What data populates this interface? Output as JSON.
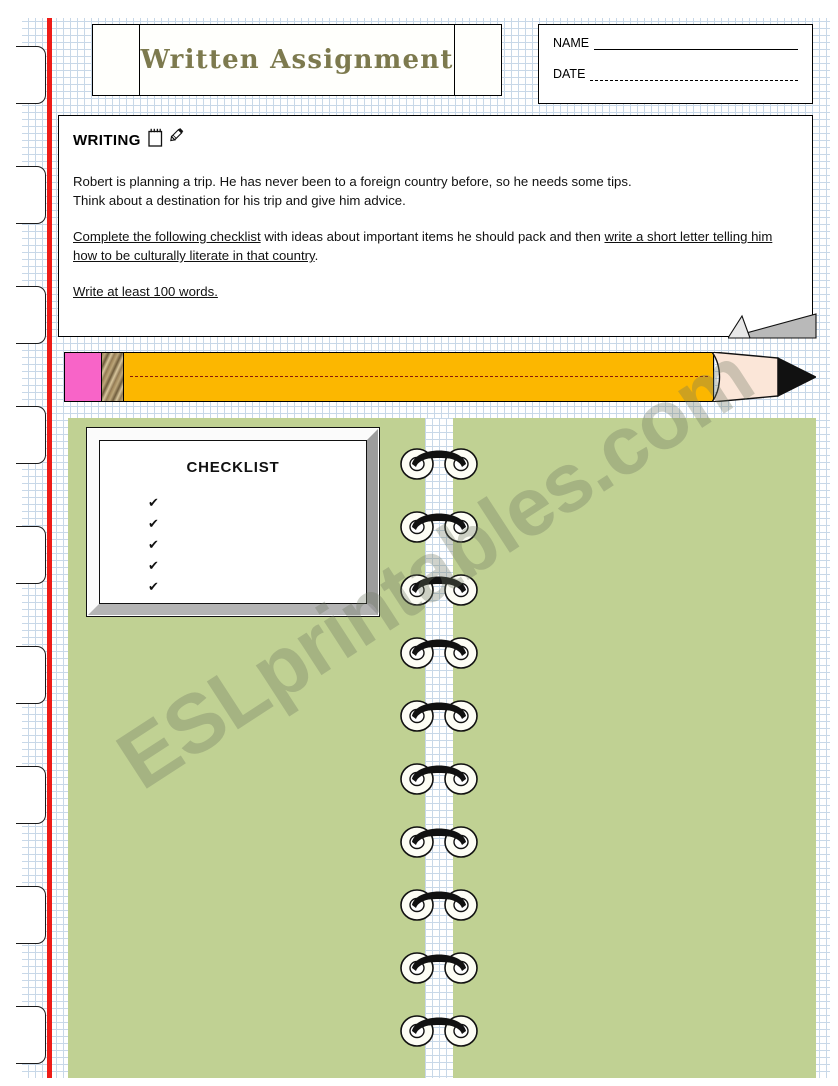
{
  "header": {
    "title": "Written Assignment",
    "name_label": "NAME",
    "date_label": "DATE"
  },
  "writing_section": {
    "heading": "WRITING",
    "heading_icons": [
      "notepad-icon",
      "pencil-icon"
    ],
    "paragraph_1_line_1": "Robert is planning a trip. He has never been to a foreign country before, so he needs some tips.",
    "paragraph_1_line_2": "Think about a destination for his trip and give him advice.",
    "paragraph_2_underlined_1": "Complete the following checklist",
    "paragraph_2_plain_1": " with ideas about important items he should pack and then ",
    "paragraph_2_underlined_2": "write a short letter telling him how to be culturally literate in that country",
    "paragraph_2_plain_2": ".",
    "paragraph_3": "Write at least 100 words."
  },
  "pencil": {
    "eraser_color": "#f864c8",
    "body_color": "#fcb700",
    "wood_color": "#fbe6d8",
    "graphite_color": "#111111"
  },
  "checklist_board": {
    "title": "CHECKLIST",
    "items": [
      "✔",
      "✔",
      "✔",
      "✔",
      "✔"
    ],
    "item_count": 5
  },
  "notebook": {
    "page_color": "#c0d193",
    "ring_count": 10,
    "margin_line_color": "#ee1c17",
    "tab_count": 9
  },
  "watermark": {
    "text": "ESLprintables.com"
  }
}
